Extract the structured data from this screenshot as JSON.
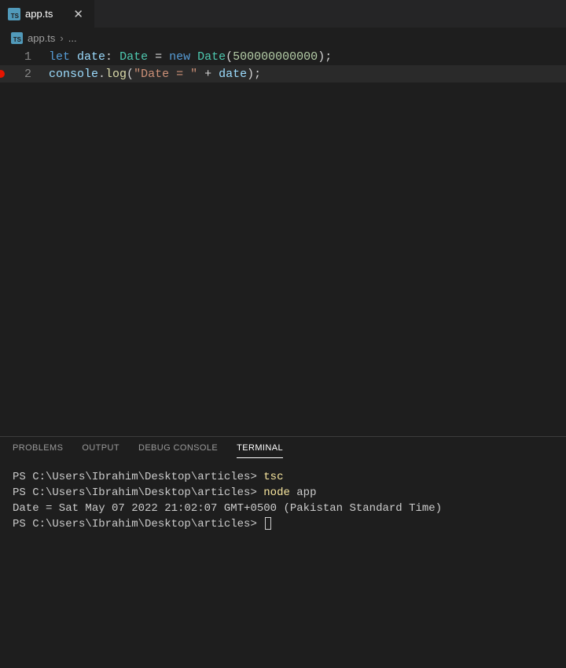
{
  "tab": {
    "filename": "app.ts",
    "icon_label": "TS"
  },
  "breadcrumb": {
    "filename": "app.ts",
    "rest": "...",
    "icon_label": "TS"
  },
  "editor": {
    "lines": [
      {
        "num": "1"
      },
      {
        "num": "2"
      }
    ],
    "tokens": {
      "let": "let",
      "date_var": "date",
      "colon_sp": ": ",
      "date_type": "Date",
      "eq": " = ",
      "new": "new",
      "sp": " ",
      "date_ctor": "Date",
      "lparen": "(",
      "num": "500000000000",
      "rparen_semi": ");",
      "console": "console",
      "dot": ".",
      "log": "log",
      "string": "\"Date = \"",
      "plus": " + ",
      "date_var2": "date"
    }
  },
  "panel": {
    "tabs": {
      "problems": "PROBLEMS",
      "output": "OUTPUT",
      "debug": "DEBUG CONSOLE",
      "terminal": "TERMINAL"
    }
  },
  "terminal": {
    "prompt": "PS C:\\Users\\Ibrahim\\Desktop\\articles> ",
    "cmd1": "tsc",
    "cmd2_a": "node",
    "cmd2_b": " app",
    "output": "Date = Sat May 07 2022 21:02:07 GMT+0500 (Pakistan Standard Time)"
  }
}
